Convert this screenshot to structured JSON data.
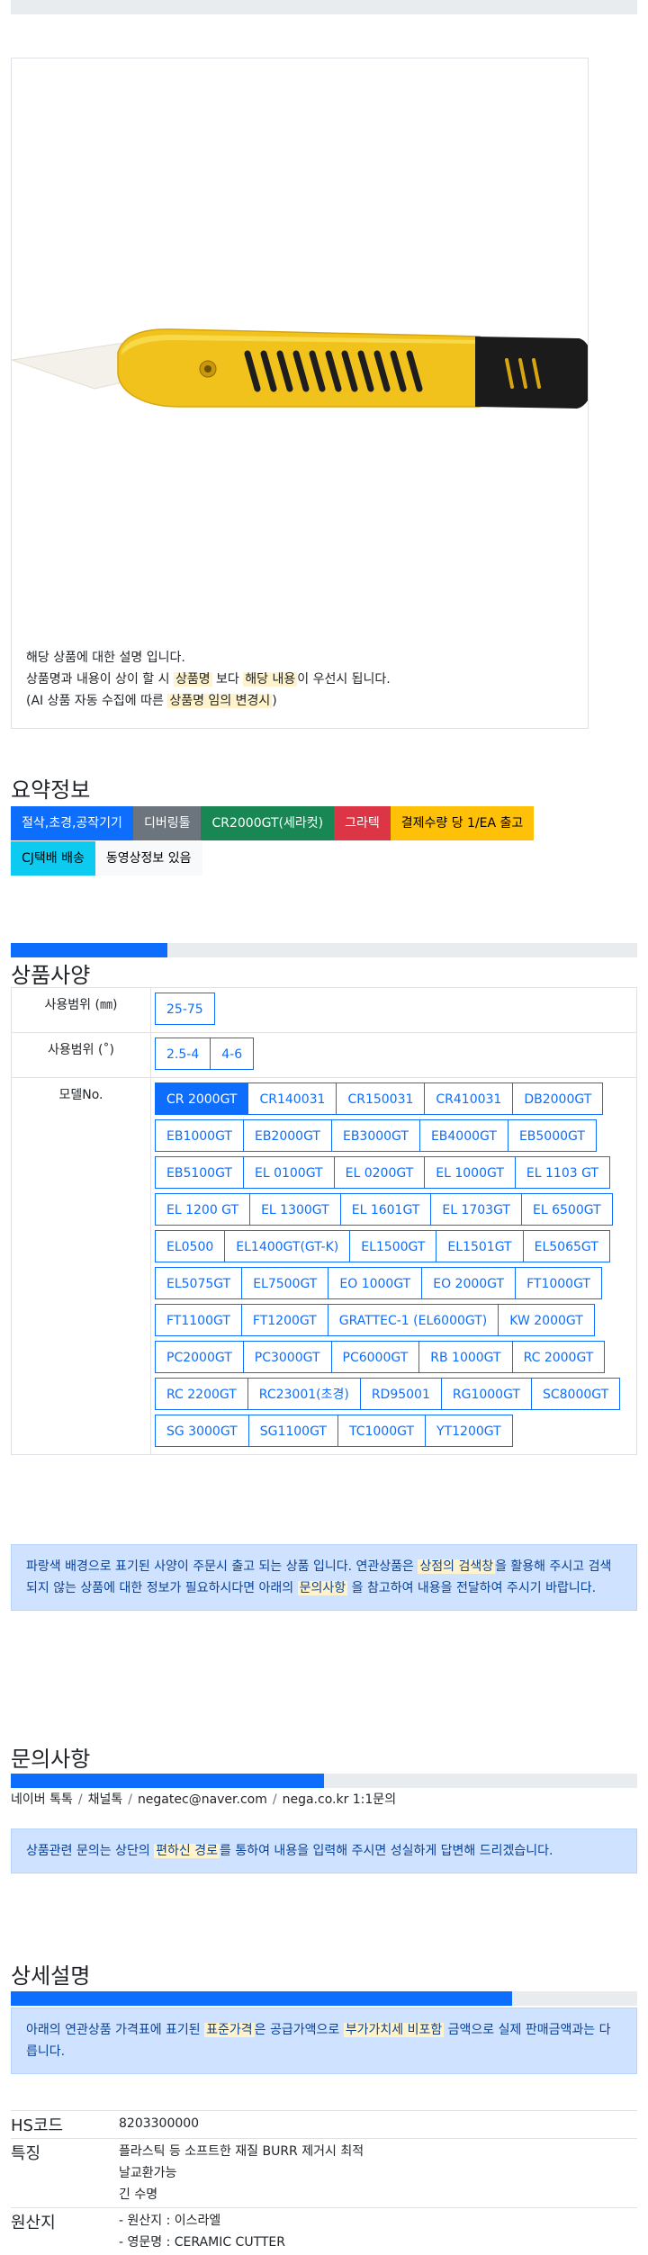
{
  "image_note": {
    "line1": "해당 상품에 대한 설명 입니다.",
    "line2_pre": "상품명과 내용이 상이 할 시 ",
    "line2_hl1": "상품명",
    "line2_mid": " 보다 ",
    "line2_hl2": "해당 내용",
    "line2_post": "이 우선시 됩니다.",
    "line3_pre": "(AI 상품 자동 수집에 따른 ",
    "line3_hl": "상품명 임의 변경시",
    "line3_post": ")"
  },
  "summary": {
    "title": "요약정보",
    "badges": [
      {
        "label": "절삭,초경,공작기기",
        "color": "#0d6efd",
        "text_color": "#ffffff"
      },
      {
        "label": "디버링툴",
        "color": "#6c757d",
        "text_color": "#ffffff"
      },
      {
        "label": "CR2000GT(세라컷)",
        "color": "#198754",
        "text_color": "#ffffff"
      },
      {
        "label": "그라텍",
        "color": "#dc3545",
        "text_color": "#ffffff"
      },
      {
        "label": "결제수량 당 1/EA 출고",
        "color": "#ffc107",
        "text_color": "#000000"
      },
      {
        "label": "CJ택배 배송",
        "color": "#0dcaf0",
        "text_color": "#000000"
      },
      {
        "label": "동영상정보 있음",
        "color": "#f8f9fa",
        "text_color": "#000000"
      }
    ]
  },
  "spec": {
    "title": "상품사양",
    "progress": 0.25,
    "rows": [
      {
        "label": "사용범위 (㎜)",
        "options": [
          "25-75"
        ]
      },
      {
        "label": "사용범위 (˚)",
        "options": [
          "2.5-4",
          "4-6"
        ]
      },
      {
        "label": "모델No.",
        "options": [
          "CR 2000GT",
          "CR140031",
          "CR150031",
          "CR410031",
          "DB2000GT",
          "EB1000GT",
          "EB2000GT",
          "EB3000GT",
          "EB4000GT",
          "EB5000GT",
          "EB5100GT",
          "EL 0100GT",
          "EL 0200GT",
          "EL 1000GT",
          "EL 1103 GT",
          "EL 1200 GT",
          "EL 1300GT",
          "EL 1601GT",
          "EL 1703GT",
          "EL 6500GT",
          "EL0500",
          "EL1400GT(GT-K)",
          "EL1500GT",
          "EL1501GT",
          "EL5065GT",
          "EL5075GT",
          "EL7500GT",
          "EO 1000GT",
          "EO 2000GT",
          "FT1000GT",
          "FT1100GT",
          "FT1200GT",
          "GRATTEC-1 (EL6000GT)",
          "KW 2000GT",
          "PC2000GT",
          "PC3000GT",
          "PC6000GT",
          "RB 1000GT",
          "RC 2000GT",
          "RC 2200GT",
          "RC23001(초경)",
          "RD95001",
          "RG1000GT",
          "SC8000GT",
          "SG 3000GT",
          "SG1100GT",
          "TC1000GT",
          "YT1200GT"
        ]
      }
    ],
    "notice_pre": "파랑색 배경으로 표기된 사양이 주문시 출고 되는 상품 입니다. 연관상품은 ",
    "notice_hl1": "상점의 검색창",
    "notice_mid": "을 활용해 주시고 검색되지 않는 상품에 대한 정보가 필요하시다면 아래의 ",
    "notice_hl2": "문의사항",
    "notice_post": " 을 참고하여 내용을 전달하여 주시기 바랍니다."
  },
  "inquiry": {
    "title": "문의사항",
    "progress": 0.5,
    "links": [
      "네이버 톡톡",
      "채널톡",
      "negatec@naver.com",
      "nega.co.kr 1:1문의"
    ],
    "notice_pre": "상품관련 문의는 상단의 ",
    "notice_hl": "편하신 경로",
    "notice_post": "를 통하여 내용을 입력해 주시면 성실하게 답변해 드리겠습니다."
  },
  "detail": {
    "title": "상세설명",
    "progress": 0.8,
    "notice_pre": "아래의 연관상품 가격표에 표기된 ",
    "notice_hl1": "표준가격",
    "notice_mid": "은 공급가액으로 ",
    "notice_hl2": "부가가치세 비포함",
    "notice_post": " 금액으로 실제 판매금액과는 다릅니다."
  },
  "info": {
    "rows": [
      {
        "key": "HS코드",
        "lines": [
          "8203300000"
        ]
      },
      {
        "key": "특징",
        "lines": [
          "플라스틱 등 소프트한 재질 BURR 제거시 최적",
          "날교환가능",
          "긴 수명"
        ]
      },
      {
        "key": "원산지",
        "lines": [
          "- 원산지 : 이스라엘",
          "- 영문명 : CERAMIC CUTTER"
        ]
      }
    ]
  }
}
